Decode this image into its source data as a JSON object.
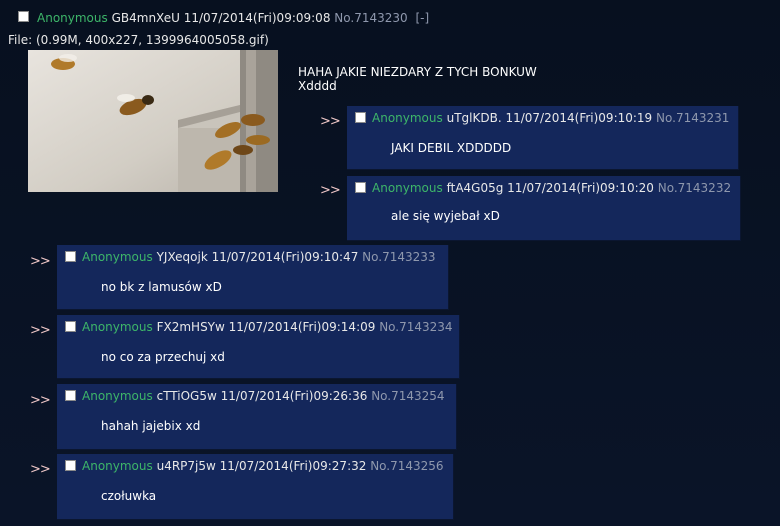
{
  "op": {
    "name": "Anonymous",
    "id": "GB4mnXeU",
    "datetime": "11/07/2014(Fri)09:09:08",
    "no": "No.7143230",
    "hide": "[-]",
    "file_info": "File: (0.99M, 400x227, 1399964005058.gif)",
    "text_line1": "HAHA JAKIE NIEZDARY Z TYCH BONKUW",
    "text_line2": "Xdddd"
  },
  "reply_arrow": ">>",
  "replies": [
    {
      "name": "Anonymous",
      "id": "uTglKDB.",
      "datetime": "11/07/2014(Fri)09:10:19",
      "no": "No.7143231",
      "text": "JAKI DEBIL XDDDDD"
    },
    {
      "name": "Anonymous",
      "id": "ftA4G05g",
      "datetime": "11/07/2014(Fri)09:10:20",
      "no": "No.7143232",
      "text": "ale się wyjebał xD"
    },
    {
      "name": "Anonymous",
      "id": "YJXeqojk",
      "datetime": "11/07/2014(Fri)09:10:47",
      "no": "No.7143233",
      "text": "no bk z lamusów xD"
    },
    {
      "name": "Anonymous",
      "id": "FX2mHSYw",
      "datetime": "11/07/2014(Fri)09:14:09",
      "no": "No.7143234",
      "text": "no co za przechuj xd"
    },
    {
      "name": "Anonymous",
      "id": "cTTiOG5w",
      "datetime": "11/07/2014(Fri)09:26:36",
      "no": "No.7143254",
      "text": "hahah jajebix xd"
    },
    {
      "name": "Anonymous",
      "id": "u4RP7j5w",
      "datetime": "11/07/2014(Fri)09:27:32",
      "no": "No.7143256",
      "text": "czołuwka"
    }
  ]
}
